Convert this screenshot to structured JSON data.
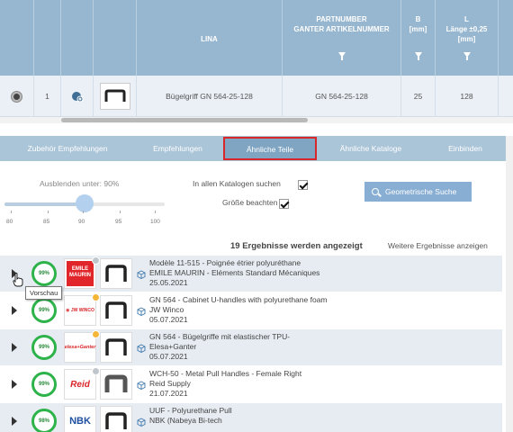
{
  "table": {
    "headers": {
      "lina": "LINA",
      "partnumber": "PARTNUMBER\nGANTER ARTIKELNUMMER",
      "b": "B\n[mm]",
      "l": "L\nLänge ±0,25\n[mm]"
    },
    "row": {
      "index": "1",
      "lina": "Bügelgriff GN 564-25-128",
      "partnumber": "GN 564-25-128",
      "b": "25",
      "l": "128"
    }
  },
  "tabs": [
    {
      "label": "Zubehör Empfehlungen"
    },
    {
      "label": "Empfehlungen"
    },
    {
      "label": "Ähnliche Teile"
    },
    {
      "label": "Ähnliche Kataloge"
    },
    {
      "label": "Einbinden"
    }
  ],
  "filters": {
    "hide_below_label": "Ausblenden unter: 90%",
    "hide_below_value": 0.5,
    "ticks": [
      "80",
      "85",
      "90",
      "95",
      "100"
    ],
    "search_all_catalogs": "In allen Katalogen suchen",
    "consider_size": "Größe beachten",
    "geo_search": "Geometrische Suche"
  },
  "results": {
    "count_text": "19 Ergebnisse werden angezeigt",
    "more_text": "Weitere Ergebnisse anzeigen",
    "tooltip": "Vorschau",
    "items": [
      {
        "percent": "99%",
        "logo": "EMILE MAURIN",
        "line1": "Modèle 11-515 - Poignée étrier polyuréthane",
        "line2": "EMILE MAURIN - Eléments Standard Mécaniques",
        "line3": "25.05.2021"
      },
      {
        "percent": "99%",
        "logo": "JW WINCO",
        "line1": "GN 564 - Cabinet U-handles with polyurethane foam",
        "line2": "JW Winco",
        "line3": "05.07.2021"
      },
      {
        "percent": "99%",
        "logo": "elesa+Ganter",
        "line1": "GN 564 - Bügelgriffe mit elastischer TPU-",
        "line2": "Elesa+Ganter",
        "line3": "05.07.2021"
      },
      {
        "percent": "99%",
        "logo": "Reid",
        "line1": "WCH-50 - Metal Pull Handles - Female Right",
        "line2": "Reid Supply",
        "line3": "21.07.2021"
      },
      {
        "percent": "98%",
        "logo": "NBK",
        "line1": "UUF - Polyurethane Pull",
        "line2": "NBK (Nabeya Bi-tech",
        "line3": ""
      }
    ]
  },
  "colors": {
    "header_bg": "#97b6cf",
    "tab_bg": "#aac4d8",
    "active_tab_border": "#d9262a",
    "match_ring": "#2db34a"
  }
}
